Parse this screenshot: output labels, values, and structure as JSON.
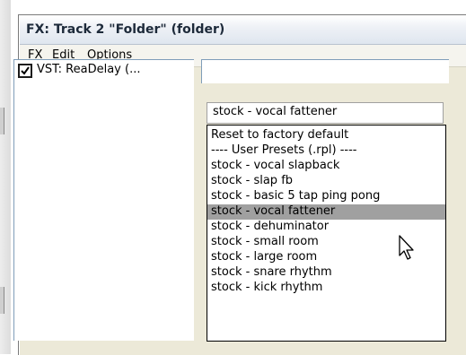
{
  "window": {
    "title": "FX: Track 2 \"Folder\" (folder)"
  },
  "menu": {
    "items": [
      "FX",
      "Edit",
      "Options"
    ]
  },
  "fx_chain": {
    "items": [
      {
        "label": "VST: ReaDelay (...",
        "enabled": true
      }
    ]
  },
  "presets": {
    "selected_value": "stock - vocal fattener",
    "options": [
      "Reset to factory default",
      "---- User Presets (.rpl) ----",
      "stock - vocal slapback",
      "stock - slap fb",
      "stock - basic 5 tap ping pong",
      "stock - vocal fattener",
      "stock - dehuminator",
      "stock - small room",
      "stock - large room",
      "stock - snare rhythm",
      "stock - kick rhythm"
    ],
    "highlighted_index": 5
  },
  "colors": {
    "highlight": "#a0a0a0",
    "window_bg": "#ece9d8",
    "list_border": "#7f9db9"
  },
  "icons": {
    "checkbox": "checkbox-checked-icon",
    "pointer": "mouse-pointer-icon"
  }
}
